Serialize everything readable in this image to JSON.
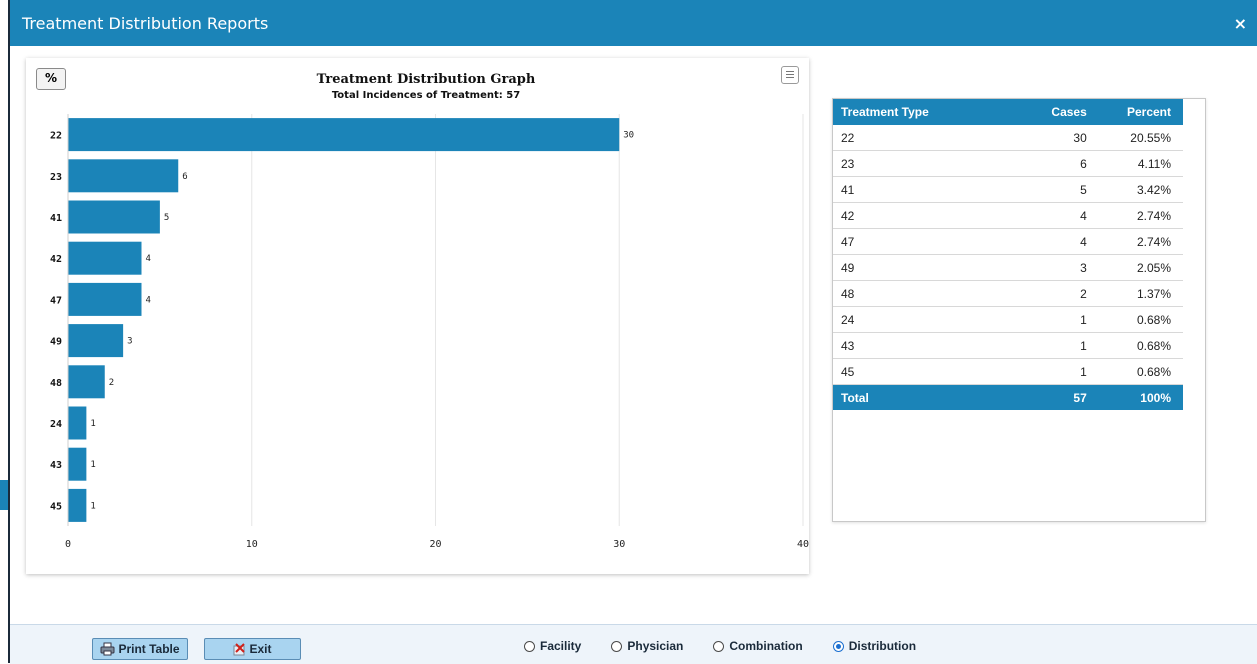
{
  "window": {
    "title": "Treatment Distribution Reports",
    "close_glyph": "×"
  },
  "chart_controls": {
    "percent_toggle_label": "%",
    "menu_icon": "hamburger-menu-icon"
  },
  "chart_data": {
    "type": "bar",
    "orientation": "horizontal",
    "title": "Treatment Distribution Graph",
    "subtitle": "Total Incidences of Treatment: 57",
    "categories": [
      "22",
      "23",
      "41",
      "42",
      "47",
      "49",
      "48",
      "24",
      "43",
      "45"
    ],
    "values": [
      30,
      6,
      5,
      4,
      4,
      3,
      2,
      1,
      1,
      1
    ],
    "xlim": [
      0,
      40
    ],
    "xticks": [
      0,
      10,
      20,
      30,
      40
    ],
    "grid": true,
    "bar_color": "#1b84b8"
  },
  "table": {
    "headers": {
      "type": "Treatment Type",
      "cases": "Cases",
      "percent": "Percent"
    },
    "rows": [
      {
        "type": "22",
        "cases": "30",
        "percent": "20.55%"
      },
      {
        "type": "23",
        "cases": "6",
        "percent": "4.11%"
      },
      {
        "type": "41",
        "cases": "5",
        "percent": "3.42%"
      },
      {
        "type": "42",
        "cases": "4",
        "percent": "2.74%"
      },
      {
        "type": "47",
        "cases": "4",
        "percent": "2.74%"
      },
      {
        "type": "49",
        "cases": "3",
        "percent": "2.05%"
      },
      {
        "type": "48",
        "cases": "2",
        "percent": "1.37%"
      },
      {
        "type": "24",
        "cases": "1",
        "percent": "0.68%"
      },
      {
        "type": "43",
        "cases": "1",
        "percent": "0.68%"
      },
      {
        "type": "45",
        "cases": "1",
        "percent": "0.68%"
      }
    ],
    "total": {
      "type": "Total",
      "cases": "57",
      "percent": "100%"
    }
  },
  "footer": {
    "print_label": "Print Table",
    "exit_label": "Exit",
    "report_options": [
      {
        "label": "Facility",
        "checked": false
      },
      {
        "label": "Physician",
        "checked": false
      },
      {
        "label": "Combination",
        "checked": false
      },
      {
        "label": "Distribution",
        "checked": true
      }
    ]
  },
  "colors": {
    "accent": "#1b84b8",
    "button_fill": "#a9d4f0"
  }
}
